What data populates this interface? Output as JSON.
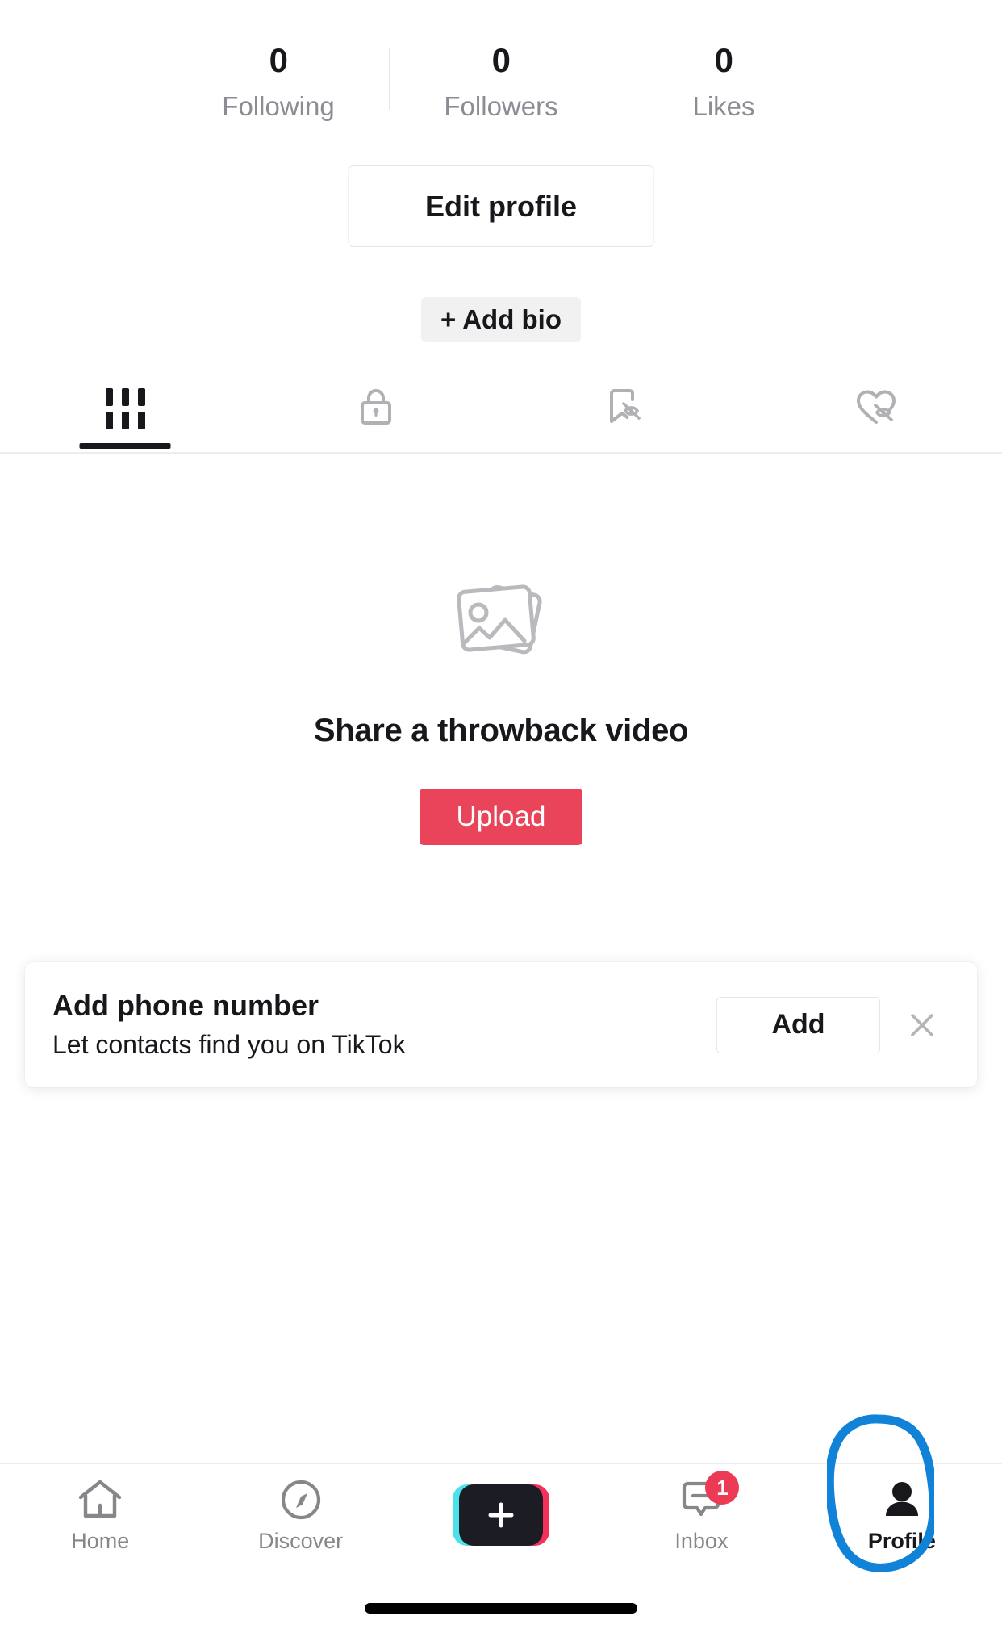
{
  "app": "TikTok",
  "colors": {
    "accent_red": "#ea445a",
    "badge_red": "#ec3a55",
    "annotation_blue": "#1082d8",
    "create_cyan": "#4ce0e8",
    "create_pink": "#f3315b",
    "text_primary": "#17171c",
    "text_muted": "#8c8c94"
  },
  "stats": [
    {
      "value": "0",
      "label": "Following",
      "name": "following"
    },
    {
      "value": "0",
      "label": "Followers",
      "name": "followers"
    },
    {
      "value": "0",
      "label": "Likes",
      "name": "likes"
    }
  ],
  "profile": {
    "edit_profile_label": "Edit profile",
    "add_bio_label": "+ Add bio"
  },
  "profile_tabs": [
    {
      "icon": "grid-icon",
      "active": true,
      "label": "Videos"
    },
    {
      "icon": "lock-icon",
      "active": false,
      "label": "Private"
    },
    {
      "icon": "bookmark-hidden-icon",
      "active": false,
      "label": "Favorites"
    },
    {
      "icon": "heart-hidden-icon",
      "active": false,
      "label": "Liked"
    }
  ],
  "empty_state": {
    "icon": "photos-stack-icon",
    "title": "Share a throwback video",
    "upload_label": "Upload"
  },
  "phone_banner": {
    "title": "Add phone number",
    "subtitle": "Let contacts find you on TikTok",
    "add_label": "Add",
    "close_icon": "close-icon"
  },
  "bottom_nav": [
    {
      "icon": "home-icon",
      "label": "Home",
      "active": false,
      "badge": null
    },
    {
      "icon": "compass-icon",
      "label": "Discover",
      "active": false,
      "badge": null
    },
    {
      "icon": "plus-icon",
      "label": "",
      "active": false,
      "badge": null
    },
    {
      "icon": "inbox-icon",
      "label": "Inbox",
      "active": false,
      "badge": "1"
    },
    {
      "icon": "person-icon",
      "label": "Profile",
      "active": true,
      "badge": null
    }
  ],
  "annotation": {
    "shape": "hand-drawn-circle",
    "target": "Profile",
    "color": "#1082d8"
  }
}
